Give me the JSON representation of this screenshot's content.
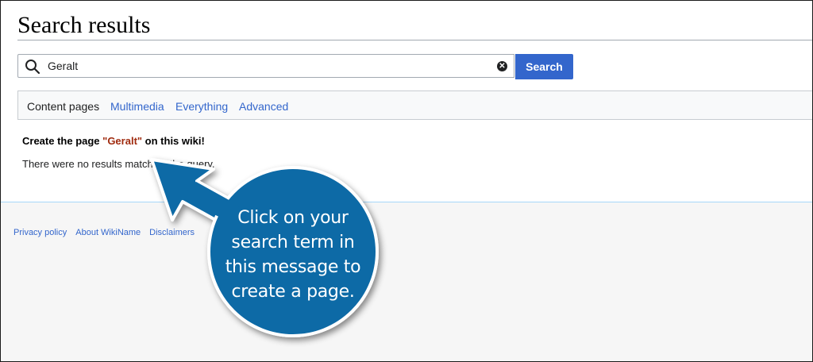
{
  "page": {
    "title": "Search results"
  },
  "search": {
    "value": "Geralt",
    "button_label": "Search",
    "clear_symbol": "✕"
  },
  "tabs": [
    {
      "label": "Content pages",
      "active": true
    },
    {
      "label": "Multimedia",
      "active": false
    },
    {
      "label": "Everything",
      "active": false
    },
    {
      "label": "Advanced",
      "active": false
    }
  ],
  "results": {
    "create_prefix": "Create the page ",
    "create_term": "\"Geralt\"",
    "create_suffix": " on this wiki!",
    "no_results_text": "There were no results matching the query."
  },
  "footer": {
    "links": [
      "Privacy policy",
      "About WikiName",
      "Disclaimers"
    ]
  },
  "callout": {
    "text": "Click on your search term in this message to create a page.",
    "fill_color": "#0f6aa6",
    "border_color": "#ffffff"
  },
  "colors": {
    "accent": "#3366cc",
    "new_link": "#a02b0f",
    "footer_bg": "#f6f6f6"
  }
}
